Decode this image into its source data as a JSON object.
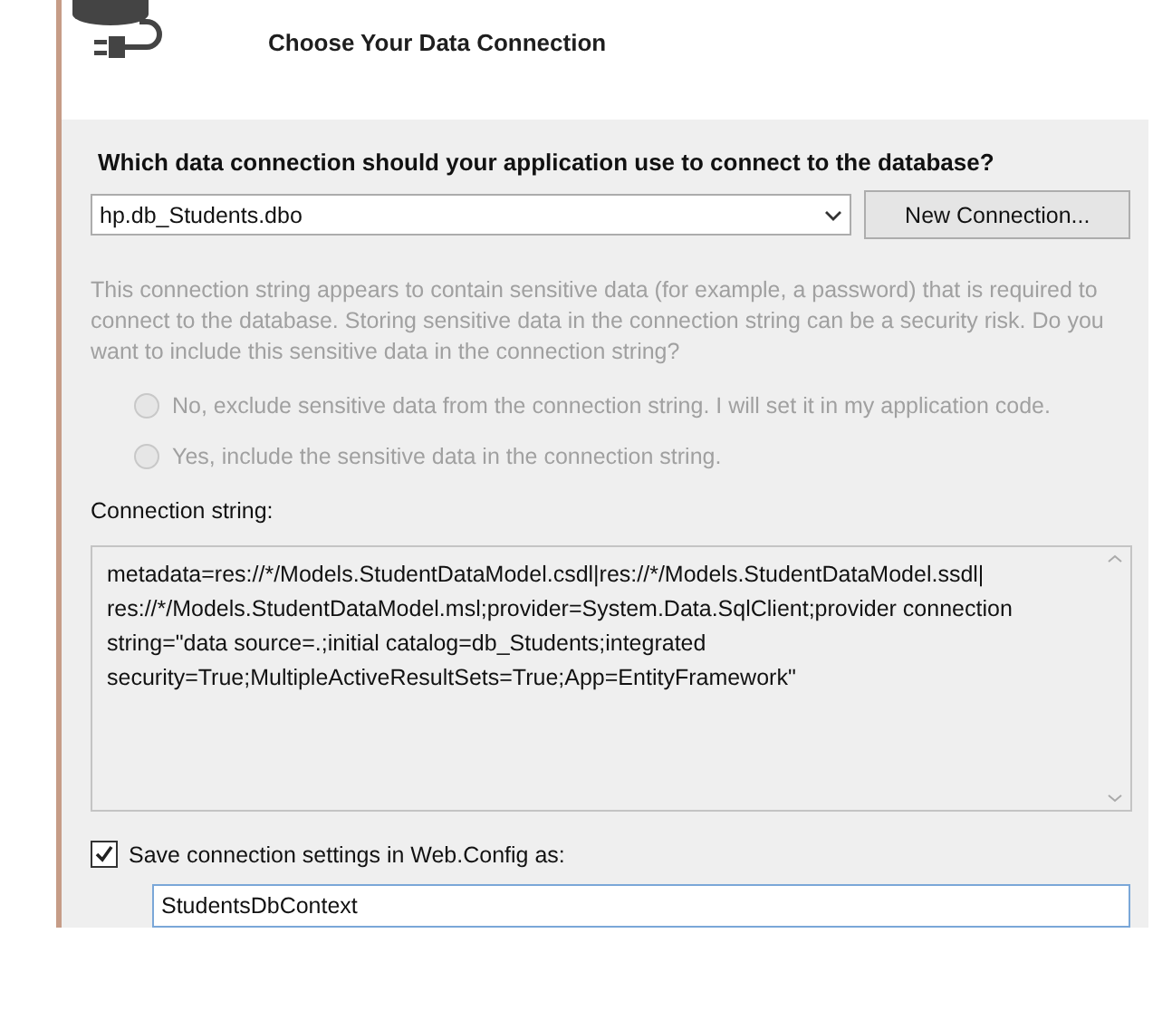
{
  "header": {
    "title": "Choose Your Data Connection"
  },
  "question": "Which data connection should your application use to connect to the database?",
  "connection_select": {
    "value": "hp.db_Students.dbo"
  },
  "new_connection_button": "New Connection...",
  "sensitive": {
    "disabled": true,
    "message": "This connection string appears to contain sensitive data (for example, a password) that is required to connect to the database. Storing sensitive data in the connection string can be a security risk. Do you want to include this sensitive data in the connection string?",
    "options": [
      {
        "label": "No, exclude sensitive data from the connection string. I will set it in my application code.",
        "selected": false
      },
      {
        "label": "Yes, include the sensitive data in the connection string.",
        "selected": false
      }
    ]
  },
  "connection_string": {
    "label": "Connection string:",
    "value": "metadata=res://*/Models.StudentDataModel.csdl|res://*/Models.StudentDataModel.ssdl| res://*/Models.StudentDataModel.msl;provider=System.Data.SqlClient;provider connection string=\"data source=.;initial catalog=db_Students;integrated security=True;MultipleActiveResultSets=True;App=EntityFramework\""
  },
  "save_settings": {
    "label": "Save connection settings in Web.Config as:",
    "checked": true,
    "name": "StudentsDbContext"
  }
}
